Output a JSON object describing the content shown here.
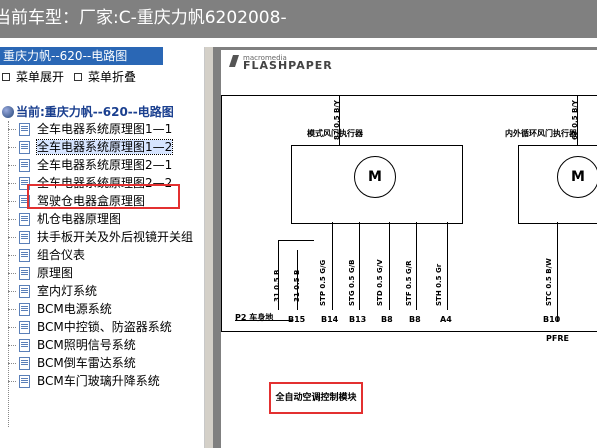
{
  "window": {
    "title": "当前车型：厂家:C-重庆力帆6202008-"
  },
  "sidebar": {
    "header": "重庆力帆--620--电路图",
    "toolbar": {
      "expand_label": "菜单展开",
      "collapse_label": "菜单折叠"
    },
    "tree_root": "当前:重庆力帆--620--电路图",
    "items": [
      {
        "label": "全车电器系统原理图1—1"
      },
      {
        "label": "全车电器系统原理图1—2"
      },
      {
        "label": "全车电器系统原理图2—1"
      },
      {
        "label": "全车电器系统原理图2—2"
      },
      {
        "label": "驾驶仓电器盒原理图"
      },
      {
        "label": "机仓电器原理图"
      },
      {
        "label": "扶手板开关及外后视镜开关组"
      },
      {
        "label": "组合仪表"
      },
      {
        "label": "原理图"
      },
      {
        "label": "室内灯系统"
      },
      {
        "label": "BCM电源系统"
      },
      {
        "label": "BCM中控锁、防盗器系统"
      },
      {
        "label": "BCM照明信号系统"
      },
      {
        "label": "BCM倒车雷达系统"
      },
      {
        "label": "BCM车门玻璃升降系统"
      }
    ],
    "selected_index": 1
  },
  "viewer": {
    "logo_top": "macromedia",
    "logo_bottom": "FLASHPAPER",
    "module_left_title": "模式风门执行器",
    "module_right_title": "内外循环风门执行器",
    "motor_label": "M",
    "wire_labels_top_left": [
      "87 0.5 B/Y"
    ],
    "wire_labels_top_right": [
      "67 0.5 B/Y"
    ],
    "wire_labels_bottom": [
      "31 0.5 B",
      "31 0.5 B",
      "STP 0.5 G/G",
      "STG 0.5 G/B",
      "STD 0.5 G/V",
      "STF 0.5 G/R",
      "STH 0.5 Gr",
      "STC 0.5 B/W"
    ],
    "pins": [
      "B15",
      "B14",
      "B13",
      "B8",
      "B8",
      "A4",
      "B10"
    ],
    "ground_label": "P2 车身地",
    "pfre_label": "PFRE",
    "callout": "全自动空调控制模块"
  }
}
